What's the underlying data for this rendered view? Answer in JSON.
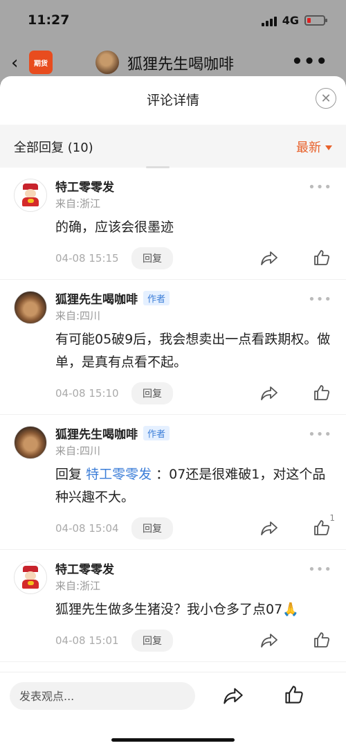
{
  "status_bar": {
    "time": "11:27",
    "network": "4G"
  },
  "app_header": {
    "logo_text": "期货",
    "title": "狐狸先生喝咖啡"
  },
  "sheet": {
    "title": "评论详情",
    "reply_count_label": "全部回复 (10)",
    "sort_label": "最新"
  },
  "comments": [
    {
      "avatar": "god-of-wealth",
      "name": "特工零零发",
      "is_author": false,
      "location": "来自:浙江",
      "text": "的确，应该会很墨迹",
      "mention": "",
      "time": "04-08 15:15",
      "reply_label": "回复",
      "likes": ""
    },
    {
      "avatar": "dog",
      "name": "狐狸先生喝咖啡",
      "is_author": true,
      "author_badge": "作者",
      "location": "来自:四川",
      "text": "有可能05破9后，我会想卖出一点看跌期权。做单，是真有点看不起。",
      "mention": "",
      "time": "04-08 15:10",
      "reply_label": "回复",
      "likes": ""
    },
    {
      "avatar": "dog",
      "name": "狐狸先生喝咖啡",
      "is_author": true,
      "author_badge": "作者",
      "location": "来自:四川",
      "reply_prefix": "回复",
      "mention": "特工零零发",
      "text": "：07还是很难破1，对这个品种兴趣不大。",
      "time": "04-08 15:04",
      "reply_label": "回复",
      "likes": "1"
    },
    {
      "avatar": "god-of-wealth",
      "name": "特工零零发",
      "is_author": false,
      "location": "来自:浙江",
      "text": "狐狸先生做多生猪没？我小仓多了点07🙏",
      "mention": "",
      "time": "04-08 15:01",
      "reply_label": "回复",
      "likes": ""
    }
  ],
  "bottom_bar": {
    "input_placeholder": "发表观点..."
  },
  "colors": {
    "accent": "#e8612b",
    "link": "#3c7ed8"
  }
}
